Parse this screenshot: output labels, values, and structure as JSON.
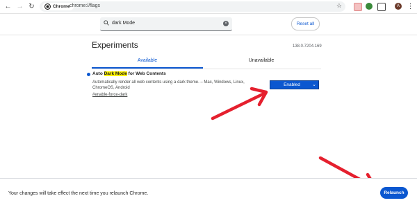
{
  "browser": {
    "chip_label": "Chrome",
    "url": "chrome://flags",
    "avatar_initial": "A"
  },
  "search": {
    "value": "dark Mode",
    "reset_label": "Reset all"
  },
  "page": {
    "title": "Experiments",
    "version": "138.0.7204.169",
    "tabs": [
      {
        "label": "Available",
        "active": true
      },
      {
        "label": "Unavailable",
        "active": false
      }
    ]
  },
  "flag": {
    "name_prefix": "Auto ",
    "name_highlight": "Dark Mode",
    "name_suffix": " for Web Contents",
    "description": "Automatically render all web contents using a dark theme. – Mac, Windows, Linux, ChromeOS, Android",
    "link": "#enable-force-dark",
    "selected_option": "Enabled"
  },
  "footer": {
    "message": "Your changes will take effect the next time you relaunch Chrome.",
    "relaunch_label": "Relaunch"
  },
  "colors": {
    "accent": "#0b57d0",
    "highlight": "#fff200",
    "annotation_arrow": "#e5202e"
  }
}
